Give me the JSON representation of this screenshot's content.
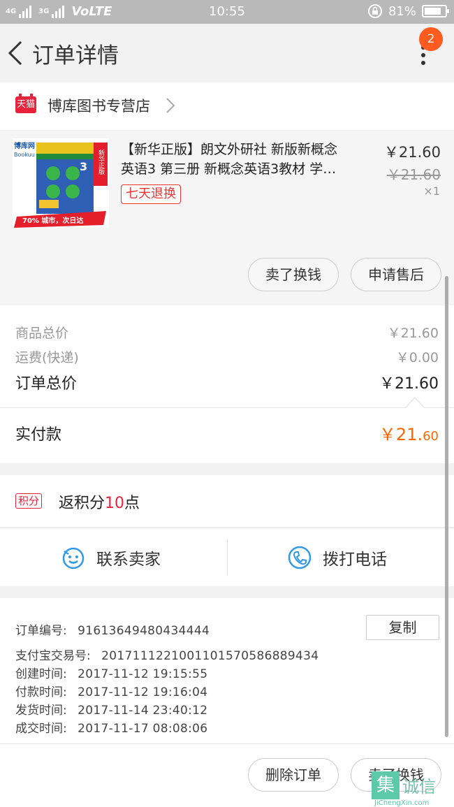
{
  "status_bar": {
    "network_left": "4G",
    "network_right": "3G",
    "carrier": "VoLTE",
    "time": "10:55",
    "battery_percent": "81%",
    "battery_level": 0.81
  },
  "header": {
    "title": "订单详情",
    "badge_count": "2"
  },
  "shop": {
    "logo_text": "天猫",
    "name": "博库图书专营店"
  },
  "product": {
    "title_line1": "【新华正版】朗文外研社 新版新概念",
    "title_line2": "英语3 第三册 新概念英语3教材 学…",
    "return_tag": "七天退换",
    "price": "￥21.60",
    "original_price": "￥21.60",
    "quantity": "×1",
    "thumb_publisher": "博库网",
    "thumb_publisher_en": "Bookuu",
    "thumb_ribbon": "新华正版",
    "thumb_banner": "70% 城市，次日达",
    "buttons": [
      "卖了换钱",
      "申请售后"
    ]
  },
  "totals": {
    "goods_label": "商品总价",
    "goods_value": "￥21.60",
    "shipping_label": "运费(快递)",
    "shipping_value": "￥0.00",
    "order_total_label": "订单总价",
    "order_total_value": "￥21.60"
  },
  "paid": {
    "label": "实付款",
    "value_main": "￥21.",
    "value_cents": "60"
  },
  "points": {
    "tag": "积分",
    "text_before": "返积分",
    "number": "10",
    "text_after": "点"
  },
  "contact": {
    "seller": "联系卖家",
    "phone": "拨打电话"
  },
  "order_info": {
    "order_no_label": "订单编号:",
    "order_no": "91613649480434444",
    "copy_button": "复制",
    "alipay_label": "支付宝交易号:",
    "alipay_no": "2017111221001101570586889434",
    "created_label": "创建时间:",
    "created": "2017-11-12  19:15:55",
    "paid_label": "付款时间:",
    "paid": "2017-11-12  19:16:04",
    "shipped_label": "发货时间:",
    "shipped": "2017-11-14  23:40:12",
    "completed_label": "成交时间:",
    "completed": "2017-11-17  08:08:06"
  },
  "footer": {
    "delete_button": "删除订单",
    "sell_button": "卖了换钱"
  },
  "watermark": {
    "logo_char": "集",
    "cn": "诚信",
    "en": "JiChengXin.com"
  },
  "colors": {
    "accent_orange": "#ff6600",
    "tmall_red": "#e6233a",
    "badge_orange": "#ff5a1f",
    "contact_blue": "#2f9be8"
  }
}
